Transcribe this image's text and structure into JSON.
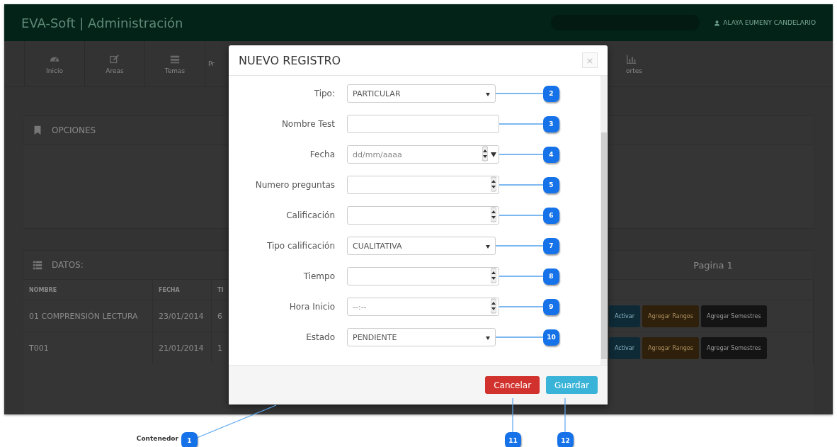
{
  "app": {
    "brand": "EVA-Soft | Administración",
    "user": "ALAYA EUMENY CANDELARIO",
    "nav": [
      {
        "label": "Inicio"
      },
      {
        "label": "Areas"
      },
      {
        "label": "Temas"
      },
      {
        "label": "Pr"
      },
      {
        "label": "ortes"
      }
    ],
    "options_panel": {
      "title": "OPCIONES"
    },
    "data_panel": {
      "title": "DATOS:",
      "page": "Pagina 1",
      "columns": [
        "NOMBRE",
        "FECHA",
        "TI"
      ],
      "rows": [
        {
          "cells": [
            "01 COMPRENSIÓN LECTURA",
            "23/01/2014",
            "6"
          ],
          "actions": [
            {
              "label": "Activar",
              "kind": "info"
            },
            {
              "label": "Agregar Rangos",
              "kind": "warning"
            },
            {
              "label": "Agregar Semestres",
              "kind": "dark"
            }
          ]
        },
        {
          "cells": [
            "T001",
            "21/01/2014",
            "1"
          ],
          "actions": [
            {
              "label": "Activar",
              "kind": "info"
            },
            {
              "label": "Agregar Rangos",
              "kind": "warning"
            },
            {
              "label": "Agregar Semestres",
              "kind": "dark"
            }
          ]
        }
      ]
    }
  },
  "modal": {
    "title": "NUEVO REGISTRO",
    "close": "×",
    "fields": [
      {
        "label": "Tipo:",
        "kind": "select",
        "value": "PARTICULAR",
        "callout": "2"
      },
      {
        "label": "Nombre Test",
        "kind": "text",
        "callout": "3"
      },
      {
        "label": "Fecha",
        "kind": "date",
        "placeholder": "dd/mm/aaaa",
        "callout": "4"
      },
      {
        "label": "Numero preguntas",
        "kind": "number",
        "callout": "5"
      },
      {
        "label": "Calificación",
        "kind": "number",
        "callout": "6"
      },
      {
        "label": "Tipo calificación",
        "kind": "select",
        "value": "CUALITATIVA",
        "callout": "7"
      },
      {
        "label": "Tiempo",
        "kind": "number",
        "callout": "8"
      },
      {
        "label": "Hora Inicio",
        "kind": "time",
        "placeholder": "--:--",
        "callout": "9"
      },
      {
        "label": "Estado",
        "kind": "select",
        "value": "PENDIENTE",
        "callout": "10"
      }
    ],
    "buttons": [
      {
        "label": "Cancelar",
        "kind": "danger",
        "callout": "11"
      },
      {
        "label": "Guardar",
        "kind": "primary",
        "callout": "12"
      }
    ]
  },
  "annotation": {
    "label": "Contenedor",
    "callout": "1"
  }
}
